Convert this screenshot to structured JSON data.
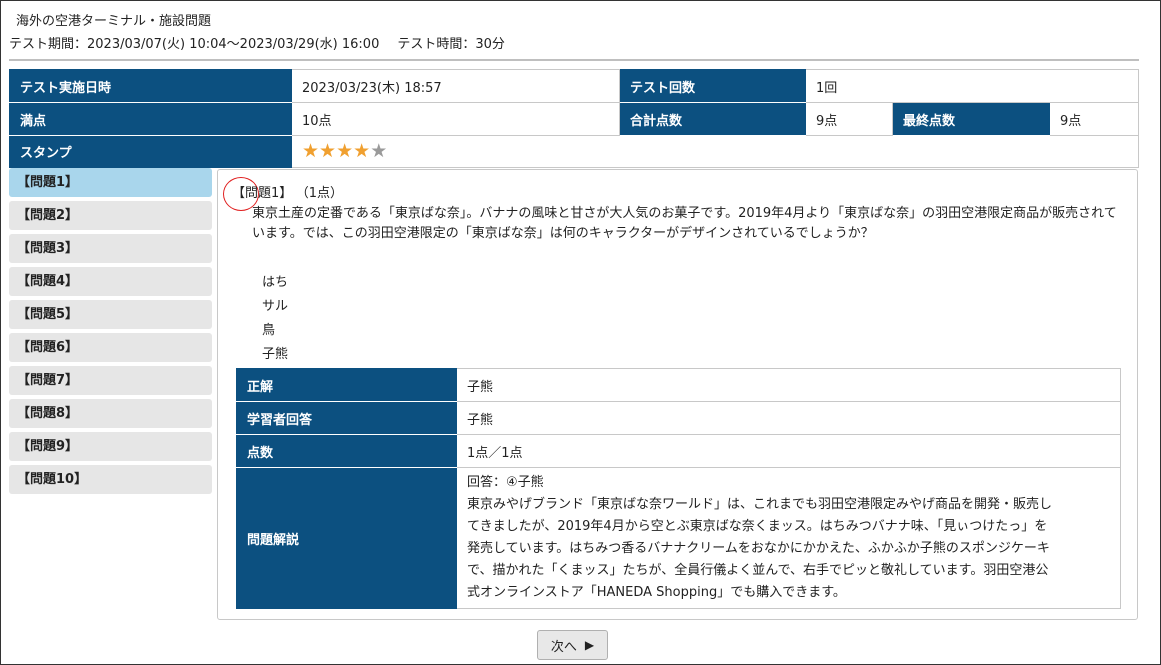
{
  "header": {
    "title": "海外の空港ターミナル・施設問題",
    "period": "テスト期間：2023/03/07(火) 10:04～2023/03/29(水) 16:00",
    "duration": "テスト時間：30分"
  },
  "info": {
    "date_label": "テスト実施日時",
    "date_value": "2023/03/23(木) 18:57",
    "count_label": "テスト回数",
    "count_value": "1回",
    "full_label": "満点",
    "full_value": "10点",
    "total_label": "合計点数",
    "total_value": "9点",
    "final_label": "最終点数",
    "final_value": "9点",
    "stamp_label": "スタンプ",
    "stamp_rating": 4,
    "stamp_max": 5,
    "stamp_on_color": "#f0a030",
    "stamp_off_color": "#9a9a9a"
  },
  "questions": [
    {
      "label": "【問題1】"
    },
    {
      "label": "【問題2】"
    },
    {
      "label": "【問題3】"
    },
    {
      "label": "【問題4】"
    },
    {
      "label": "【問題5】"
    },
    {
      "label": "【問題6】"
    },
    {
      "label": "【問題7】"
    },
    {
      "label": "【問題8】"
    },
    {
      "label": "【問題9】"
    },
    {
      "label": "【問題10】"
    }
  ],
  "active_question": 0,
  "detail": {
    "title": "【問題1】",
    "points": "（1点）",
    "text": "東京土産の定番である「東京ばな奈」。バナナの風味と甘さが大人気のお菓子です。2019年4月より「東京ばな奈」の羽田空港限定商品が販売されています。では、この羽田空港限定の「東京ばな奈」は何のキャラクターがデザインされているでしょうか？",
    "choices": [
      "はち",
      "サル",
      "鳥",
      "子熊"
    ],
    "correct_label": "正解",
    "correct_value": "子熊",
    "answer_label": "学習者回答",
    "answer_value": "子熊",
    "score_label": "点数",
    "score_value": "1点／1点",
    "explain_label": "問題解説",
    "explain_lines": [
      "回答：④子熊",
      "東京みやげブランド「東京ばな奈ワールド」は、これまでも羽田空港限定みやげ商品を開発・販売し",
      "てきましたが、2019年4月から空とぶ東京ばな奈くまッス。はちみつバナナ味、「見ぃつけたっ」を",
      "発売しています。はちみつ香るバナナクリームをおなかにかかえた、ふかふか子熊のスポンジケーキ",
      "で、描かれた「くまッス」たちが、全員行儀よく並んで、右手でピッと敬礼しています。羽田空港公",
      "式オンラインストア「HANEDA Shopping」でも購入できます。"
    ]
  },
  "nav": {
    "next_label": "次へ",
    "next_icon": "play-triangle-icon"
  },
  "accent_color": "#0c5080",
  "active_color": "#a9d6ec"
}
